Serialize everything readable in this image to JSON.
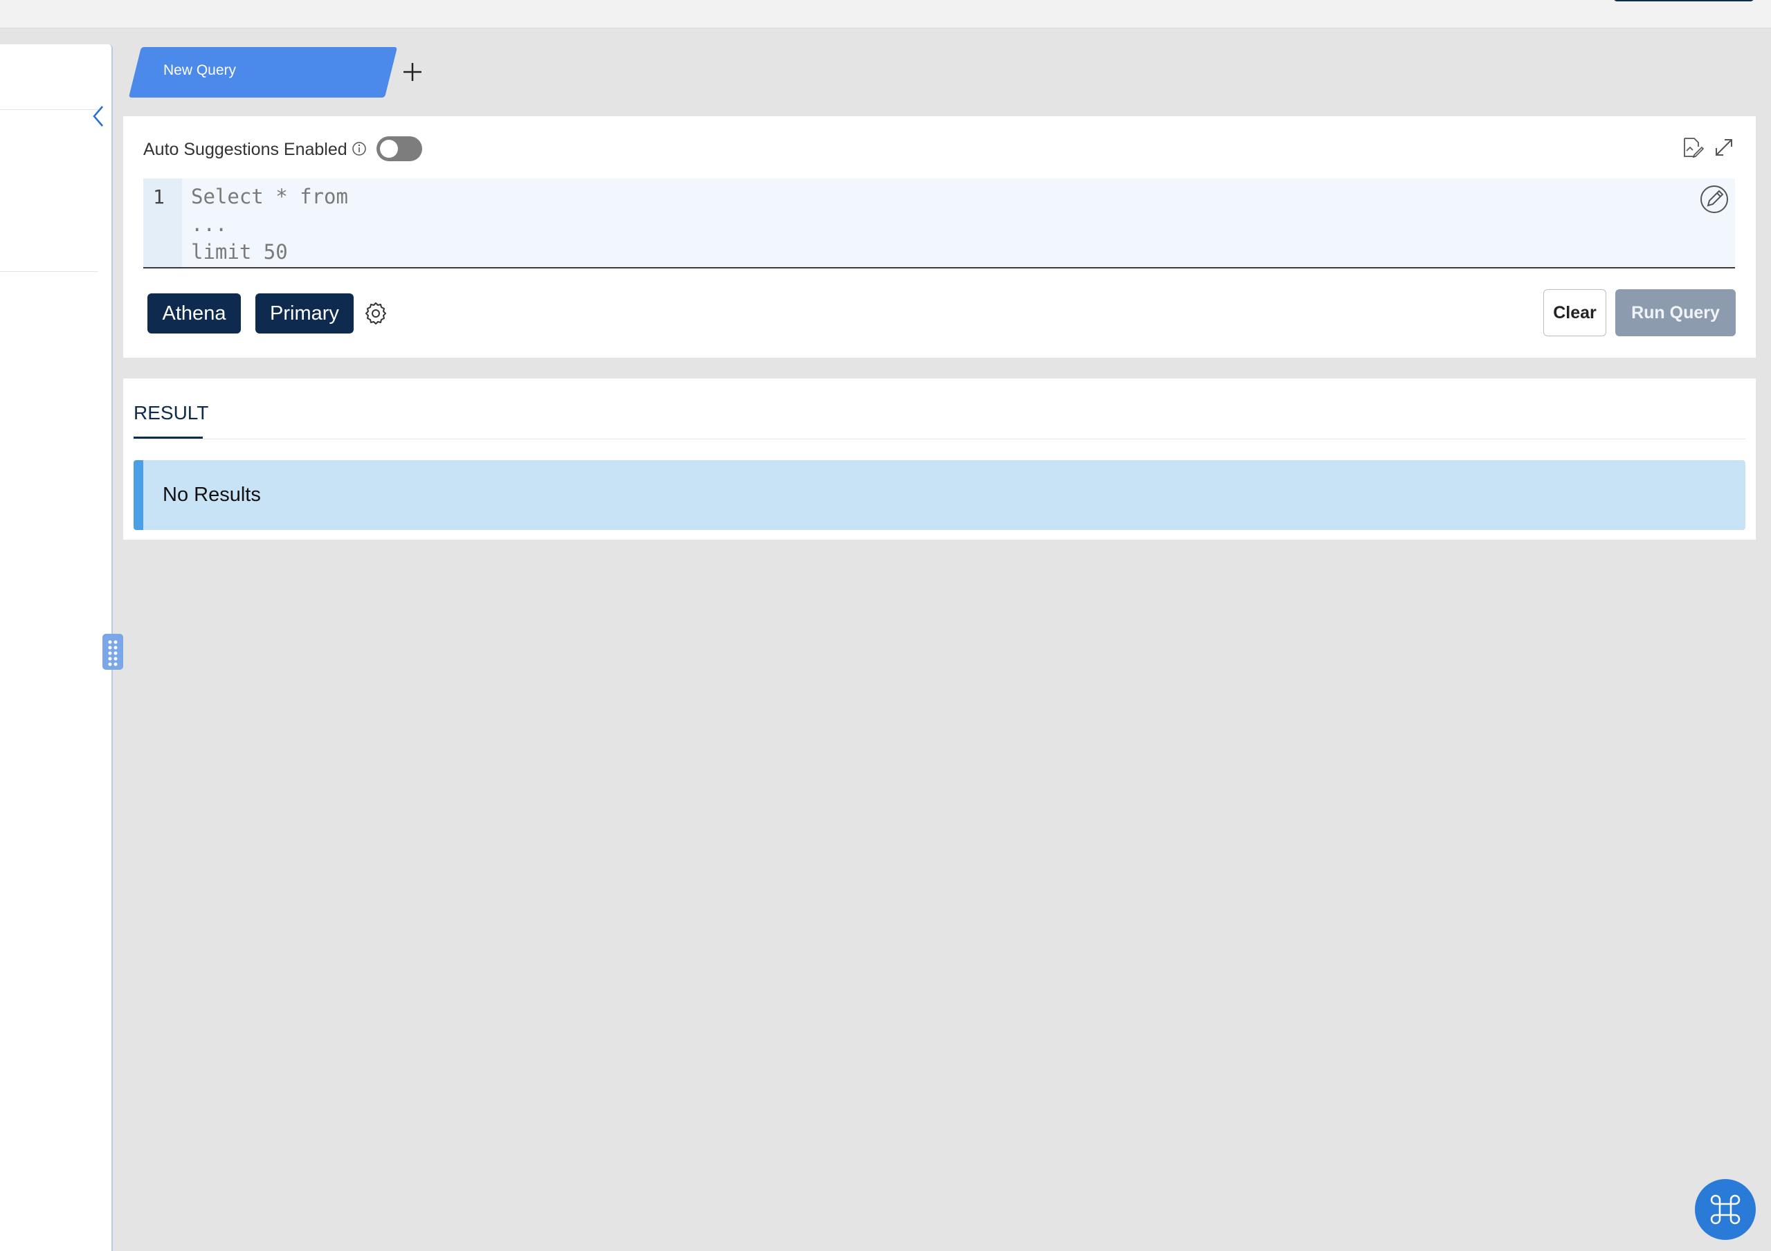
{
  "tabs": [
    {
      "label": "New Query",
      "active": true
    }
  ],
  "editor": {
    "auto_suggestions_label": "Auto Suggestions Enabled",
    "auto_suggestions_enabled": false,
    "line_numbers": [
      "1"
    ],
    "code_lines": [
      "Select * from",
      "...",
      "limit 50"
    ],
    "chips": [
      {
        "label": "Athena"
      },
      {
        "label": "Primary"
      }
    ],
    "clear_label": "Clear",
    "run_label": "Run Query"
  },
  "result": {
    "tab_label": "RESULT",
    "message": "No Results"
  },
  "colors": {
    "tab_accent": "#4b89ea",
    "chip_bg": "#0e2a4e",
    "run_disabled_bg": "#8c9bad",
    "info_banner_bg": "#c9e3f6",
    "fab_bg": "#2a7bd8"
  },
  "icons": [
    "chevron-left-icon",
    "plus-icon",
    "info-icon",
    "save-icon",
    "expand-icon",
    "ai-edit-icon",
    "gear-icon",
    "drag-handle-icon",
    "command-icon"
  ]
}
